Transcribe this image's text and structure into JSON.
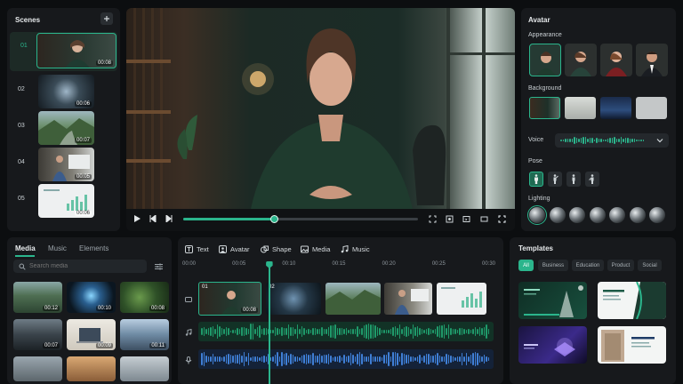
{
  "scenes": {
    "title": "Scenes",
    "items": [
      {
        "num": "01",
        "duration": "00:08"
      },
      {
        "num": "02",
        "duration": "00:06"
      },
      {
        "num": "03",
        "duration": "00:07"
      },
      {
        "num": "04",
        "duration": "00:05"
      },
      {
        "num": "05",
        "duration": "00:06"
      }
    ]
  },
  "avatar_panel": {
    "title": "Avatar",
    "appearance_label": "Appearance",
    "background_label": "Background",
    "voice_label": "Voice",
    "pose_label": "Pose",
    "lighting_label": "Lighting"
  },
  "media": {
    "tabs": [
      "Media",
      "Music",
      "Elements"
    ],
    "search_placeholder": "Search media",
    "items": [
      {
        "duration": "00:12"
      },
      {
        "duration": "00:10"
      },
      {
        "duration": "00:08"
      },
      {
        "duration": "00:07"
      },
      {
        "duration": "00:09"
      },
      {
        "duration": "00:11"
      },
      {
        "duration": ""
      },
      {
        "duration": ""
      },
      {
        "duration": ""
      }
    ]
  },
  "toolbar": {
    "items": [
      "Text",
      "Avatar",
      "Shape",
      "Media",
      "Music"
    ]
  },
  "timeline": {
    "ticks": [
      "00:00",
      "00:05",
      "00:10",
      "00:15",
      "00:20",
      "00:25",
      "00:30"
    ],
    "clips": [
      {
        "label": "01",
        "duration": "00:08"
      },
      {
        "label": "02"
      },
      {
        "label": ""
      },
      {
        "label": ""
      },
      {
        "label": ""
      }
    ],
    "playhead_seconds": 8
  },
  "player": {
    "progress": 0.39
  },
  "templates": {
    "title": "Templates",
    "filters": [
      "All",
      "Business",
      "Education",
      "Product",
      "Social"
    ]
  },
  "colors": {
    "accent": "#2bb58c",
    "audio_green": "#1f9a6a",
    "audio_blue": "#3f7fd6"
  }
}
